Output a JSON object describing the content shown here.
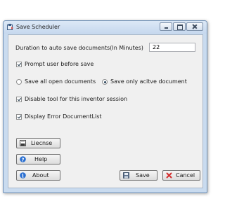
{
  "window": {
    "title": "Save Scheduler"
  },
  "form": {
    "duration_label": "Duration to auto save documents(In Minutes)",
    "duration_value": "22",
    "prompt_label": "Prompt user before save",
    "prompt_checked": true,
    "save_all_label": "Save all open documents",
    "save_active_label": "Save only acitve document",
    "selected_save_mode": "active",
    "disable_tool_label": "Disable tool for this inventor session",
    "disable_tool_checked": true,
    "display_error_label": "Display Error DocumentList",
    "display_error_checked": true
  },
  "buttons": {
    "license_label": "Liecnse",
    "help_label": "Help",
    "about_label": "About",
    "save_label": "Save",
    "cancel_label": "Cancel"
  },
  "icons": {
    "app": "scheduler-icon",
    "license": "license-icon",
    "help": "help-icon",
    "about": "info-icon",
    "save": "floppy-disk-icon",
    "cancel": "cancel-x-icon"
  },
  "colors": {
    "titlebar": "#c9dbef",
    "client": "#f0f0f0",
    "help_icon_blue": "#2a6fd1",
    "cancel_red": "#d32f2f"
  }
}
